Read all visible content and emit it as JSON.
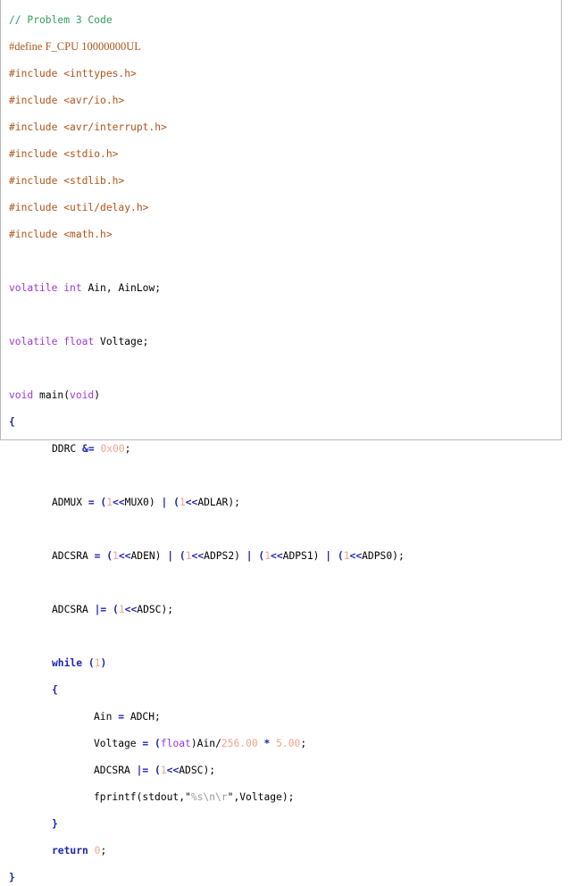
{
  "comment": "// Problem 3 Code",
  "define": "#define F_CPU 10000000UL",
  "includes": [
    "#include <inttypes.h>",
    "#include <avr/io.h>",
    "#include <avr/interrupt.h>",
    "#include <stdio.h>",
    "#include <stdlib.h>",
    "#include <util/delay.h>",
    "#include <math.h>"
  ],
  "decl1": {
    "kw1": "volatile",
    "kw2": "int",
    "rest": " Ain, AinLow;"
  },
  "decl2": {
    "kw1": "volatile",
    "kw2": "float",
    "rest": " Voltage;"
  },
  "main_sig": {
    "kw": "void",
    "rest": " main(",
    "arg": "void",
    "close": ")"
  },
  "brace_open": "{",
  "brace_close": "}",
  "ddrc": {
    "lhs": "DDRC ",
    "op": "&=",
    "val": "0x00",
    "end": ";"
  },
  "admux": {
    "lhs": "ADMUX ",
    "eq": "=",
    "p1": " (",
    "n1": "1",
    "sh1": "<<",
    "r1": "MUX0)",
    "or": "|",
    "p2": " (",
    "n2": "1",
    "sh2": "<<",
    "r2": "ADLAR)",
    "end": ";"
  },
  "adcsra1": {
    "lhs": "ADCSRA ",
    "eq": "=",
    "terms": [
      {
        "n": "1",
        "sh": "<<",
        "name": "ADEN)"
      },
      {
        "n": "1",
        "sh": "<<",
        "name": "ADPS2)"
      },
      {
        "n": "1",
        "sh": "<<",
        "name": "ADPS1)"
      },
      {
        "n": "1",
        "sh": "<<",
        "name": "ADPS0)"
      }
    ],
    "or": "|",
    "end": ";"
  },
  "adcsra2": {
    "lhs": "ADCSRA ",
    "op": "|=",
    "n": "1",
    "sh": "<<",
    "name": "ADSC)",
    "end": ";"
  },
  "while_line": {
    "kw": "while",
    "open": " (",
    "n": "1",
    "close": ")"
  },
  "loop": {
    "ain": {
      "lhs": "Ain ",
      "eq": "=",
      "rhs": " ADCH;"
    },
    "voltage": {
      "lhs": "Voltage ",
      "eq": "=",
      "p": " (",
      "cast": "float",
      "mid": ")Ain/",
      "n1": "256.00",
      "mul": "*",
      "n2": "5.00",
      "end": ";"
    },
    "adcsra": {
      "lhs": "ADCSRA ",
      "op": "|=",
      "p": " (",
      "n": "1",
      "sh": "<<",
      "name": "ADSC)",
      "end": ";"
    },
    "fprintf": {
      "pre": "fprintf(stdout,\"",
      "fmt": "%s\\n\\r",
      "post": "\",Voltage);"
    }
  },
  "return_line": {
    "kw": "return",
    "val": "0",
    "end": ";"
  }
}
